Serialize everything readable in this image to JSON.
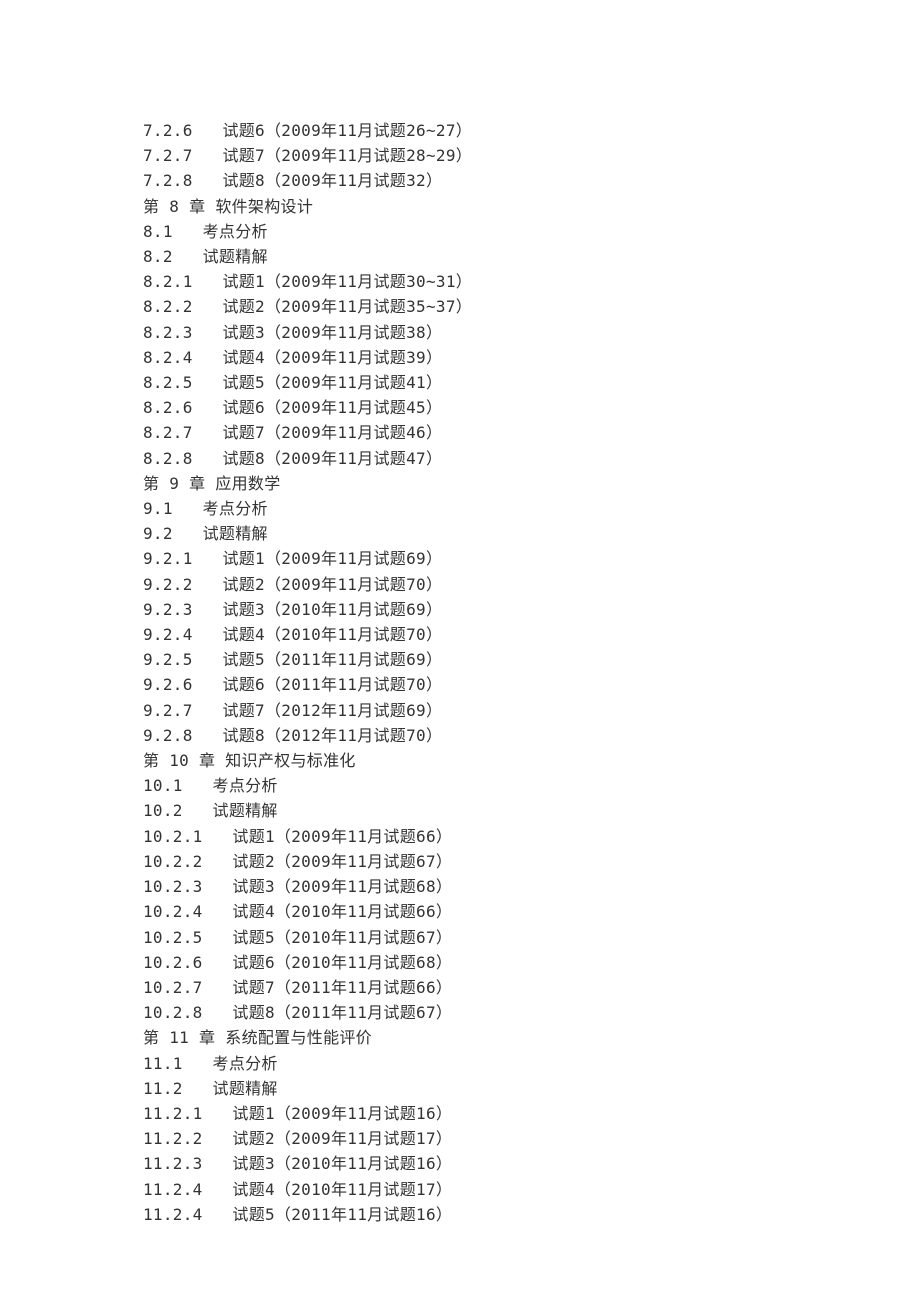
{
  "lines": [
    "7.2.6   试题6（2009年11月试题26~27）",
    "7.2.7   试题7（2009年11月试题28~29）",
    "7.2.8   试题8（2009年11月试题32）",
    "第 8 章 软件架构设计",
    "8.1   考点分析",
    "8.2   试题精解",
    "8.2.1   试题1（2009年11月试题30~31）",
    "8.2.2   试题2（2009年11月试题35~37）",
    "8.2.3   试题3（2009年11月试题38）",
    "8.2.4   试题4（2009年11月试题39）",
    "8.2.5   试题5（2009年11月试题41）",
    "8.2.6   试题6（2009年11月试题45）",
    "8.2.7   试题7（2009年11月试题46）",
    "8.2.8   试题8（2009年11月试题47）",
    "第 9 章 应用数学",
    "9.1   考点分析",
    "9.2   试题精解",
    "9.2.1   试题1（2009年11月试题69）",
    "9.2.2   试题2（2009年11月试题70）",
    "9.2.3   试题3（2010年11月试题69）",
    "9.2.4   试题4（2010年11月试题70）",
    "9.2.5   试题5（2011年11月试题69）",
    "9.2.6   试题6（2011年11月试题70）",
    "9.2.7   试题7（2012年11月试题69）",
    "9.2.8   试题8（2012年11月试题70）",
    "第 10 章 知识产权与标准化",
    "10.1   考点分析",
    "10.2   试题精解",
    "10.2.1   试题1（2009年11月试题66）",
    "10.2.2   试题2（2009年11月试题67）",
    "10.2.3   试题3（2009年11月试题68）",
    "10.2.4   试题4（2010年11月试题66）",
    "10.2.5   试题5（2010年11月试题67）",
    "10.2.6   试题6（2010年11月试题68）",
    "10.2.7   试题7（2011年11月试题66）",
    "10.2.8   试题8（2011年11月试题67）",
    "第 11 章 系统配置与性能评价",
    "11.1   考点分析",
    "11.2   试题精解",
    "11.2.1   试题1（2009年11月试题16）",
    "11.2.2   试题2（2009年11月试题17）",
    "11.2.3   试题3（2010年11月试题16）",
    "11.2.4   试题4（2010年11月试题17）",
    "11.2.4   试题5（2011年11月试题16）"
  ]
}
